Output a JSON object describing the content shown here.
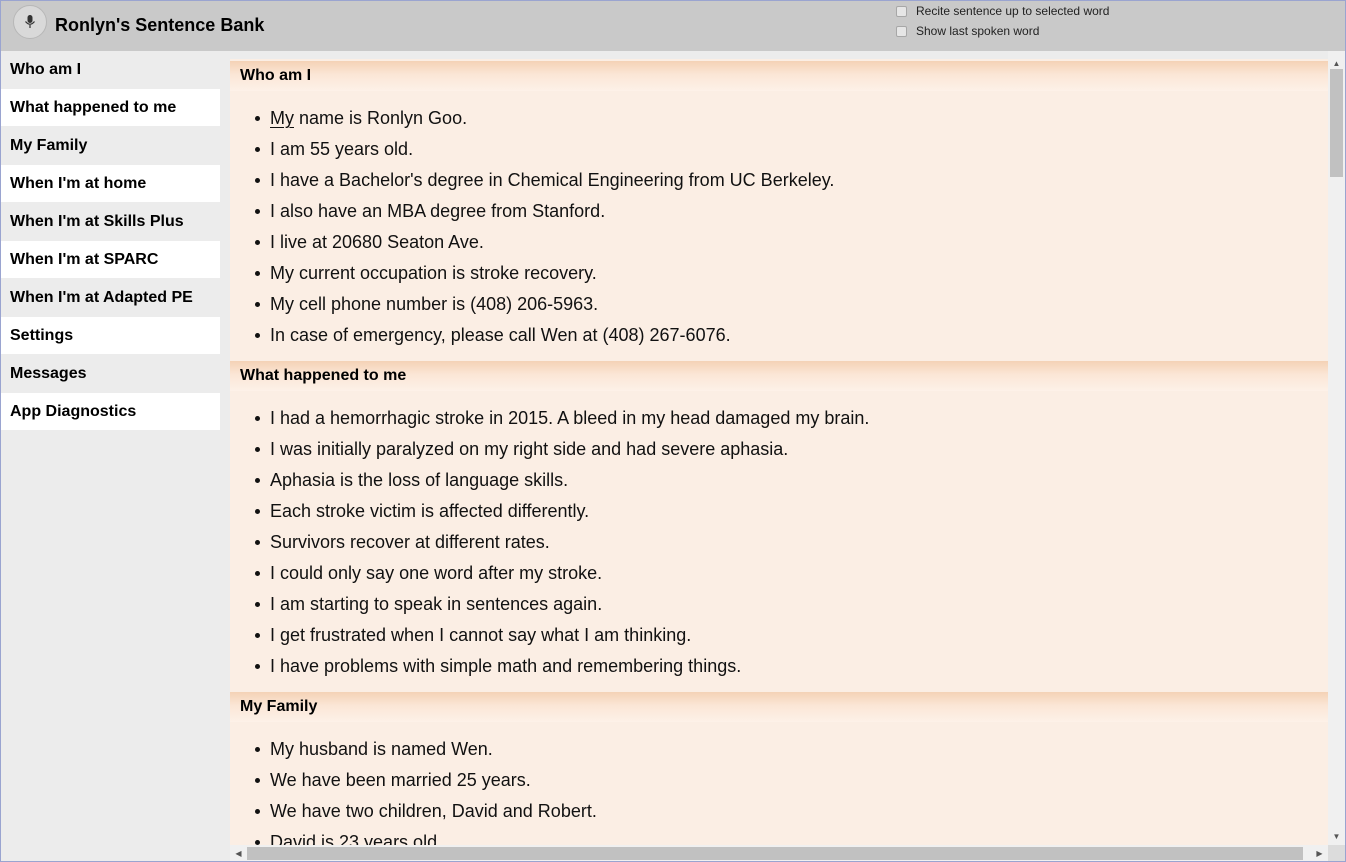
{
  "header": {
    "title": "Ronlyn's Sentence Bank",
    "mic_icon": "microphone-icon",
    "options": [
      {
        "label": "Recite sentence up to selected word",
        "checked": false
      },
      {
        "label": "Show last spoken word",
        "checked": false
      }
    ]
  },
  "sidebar": {
    "items": [
      {
        "label": "Who am I"
      },
      {
        "label": "What happened to me"
      },
      {
        "label": "My Family"
      },
      {
        "label": "When I'm at home"
      },
      {
        "label": "When I'm at Skills Plus"
      },
      {
        "label": "When I'm at SPARC"
      },
      {
        "label": "When I'm at Adapted PE"
      },
      {
        "label": "Settings"
      },
      {
        "label": "Messages"
      },
      {
        "label": "App Diagnostics"
      }
    ]
  },
  "sections": [
    {
      "title": "Who am I",
      "sentences": [
        {
          "first": "My",
          "rest": " name is Ronlyn Goo."
        },
        {
          "text": "I am 55 years old."
        },
        {
          "text": "I have a Bachelor's degree in Chemical Engineering from UC Berkeley."
        },
        {
          "text": "I also have an MBA degree from Stanford."
        },
        {
          "text": "I live at 20680 Seaton Ave."
        },
        {
          "text": "My current occupation is stroke recovery."
        },
        {
          "text": "My cell phone number is (408) 206-5963."
        },
        {
          "text": "In case of emergency, please call Wen at (408) 267-6076."
        }
      ]
    },
    {
      "title": "What happened to me",
      "sentences": [
        {
          "text": "I had a hemorrhagic stroke in 2015. A bleed in my head damaged my brain."
        },
        {
          "text": "I was initially paralyzed on my right side and had severe aphasia."
        },
        {
          "text": "Aphasia is the loss of language skills."
        },
        {
          "text": "Each stroke victim is affected differently."
        },
        {
          "text": "Survivors recover at different rates."
        },
        {
          "text": "I could only say one word after my stroke."
        },
        {
          "text": "I am starting to speak in sentences again."
        },
        {
          "text": "I get frustrated when I cannot say what I am thinking."
        },
        {
          "text": "I have problems with simple math and remembering things."
        }
      ]
    },
    {
      "title": "My Family",
      "sentences": [
        {
          "text": "My husband is named Wen."
        },
        {
          "text": "We have been married 25 years."
        },
        {
          "text": "We have two children, David and Robert."
        },
        {
          "text": "David is 23 years old."
        }
      ]
    }
  ]
}
